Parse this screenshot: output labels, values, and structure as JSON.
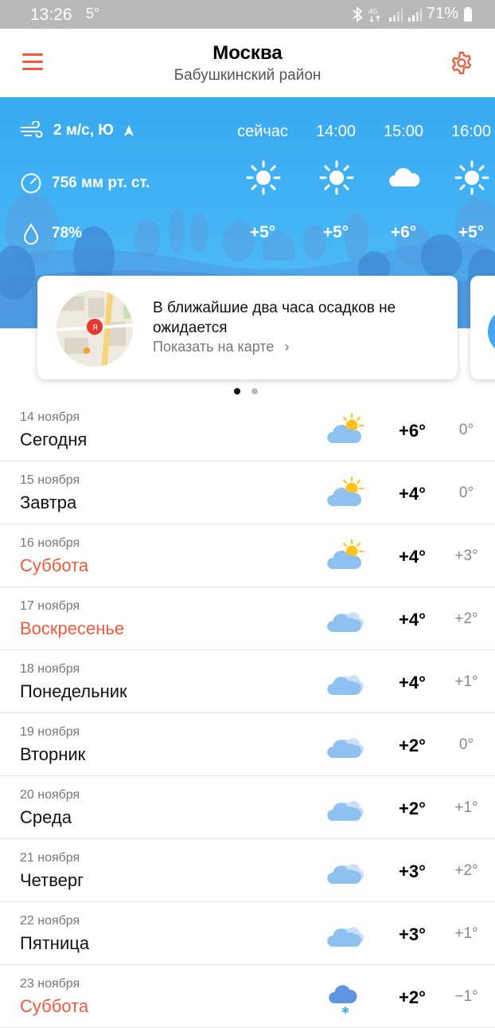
{
  "status_bar": {
    "time": "13:26",
    "temp": "5°",
    "battery": "71%",
    "icons": [
      "bluetooth-icon",
      "4g-icon",
      "signal-icon",
      "signal-icon",
      "battery-icon"
    ]
  },
  "header": {
    "city": "Москва",
    "district": "Бабушкинский район",
    "menu_icon": "menu-icon",
    "settings_icon": "gear-icon"
  },
  "current": {
    "wind": "2 м/с, Ю",
    "pressure": "756 мм рт. ст.",
    "humidity": "78%"
  },
  "hourly": [
    {
      "time": "сейчас",
      "icon": "sun",
      "temp": "+5°"
    },
    {
      "time": "14:00",
      "icon": "sun",
      "temp": "+5°"
    },
    {
      "time": "15:00",
      "icon": "cloud",
      "temp": "+6°"
    },
    {
      "time": "16:00",
      "icon": "sun",
      "temp": "+5°"
    }
  ],
  "card": {
    "message": "В ближайшие два часа осадков не ожидается",
    "link": "Показать на карте",
    "pages": 2,
    "active_page": 0
  },
  "forecast": [
    {
      "date": "14 ноября",
      "day": "Сегодня",
      "icon": "partly-cloudy",
      "max": "+6°",
      "min": "0°",
      "weekend": false
    },
    {
      "date": "15 ноября",
      "day": "Завтра",
      "icon": "partly-cloudy",
      "max": "+4°",
      "min": "0°",
      "weekend": false
    },
    {
      "date": "16 ноября",
      "day": "Суббота",
      "icon": "partly-cloudy",
      "max": "+4°",
      "min": "+3°",
      "weekend": true
    },
    {
      "date": "17 ноября",
      "day": "Воскресенье",
      "icon": "cloudy",
      "max": "+4°",
      "min": "+2°",
      "weekend": true
    },
    {
      "date": "18 ноября",
      "day": "Понедельник",
      "icon": "cloudy",
      "max": "+4°",
      "min": "+1°",
      "weekend": false
    },
    {
      "date": "19 ноября",
      "day": "Вторник",
      "icon": "cloudy",
      "max": "+2°",
      "min": "0°",
      "weekend": false
    },
    {
      "date": "20 ноября",
      "day": "Среда",
      "icon": "cloudy",
      "max": "+2°",
      "min": "+1°",
      "weekend": false
    },
    {
      "date": "21 ноября",
      "day": "Четверг",
      "icon": "cloudy",
      "max": "+3°",
      "min": "+2°",
      "weekend": false
    },
    {
      "date": "22 ноября",
      "day": "Пятница",
      "icon": "cloudy",
      "max": "+3°",
      "min": "+1°",
      "weekend": false
    },
    {
      "date": "23 ноября",
      "day": "Суббота",
      "icon": "snow",
      "max": "+2°",
      "min": "−1°",
      "weekend": true
    }
  ],
  "colors": {
    "accent": "#f05a3c",
    "sky": "#43b4f5",
    "cloud": "#8fc1f0",
    "sun": "#ffc21f"
  }
}
